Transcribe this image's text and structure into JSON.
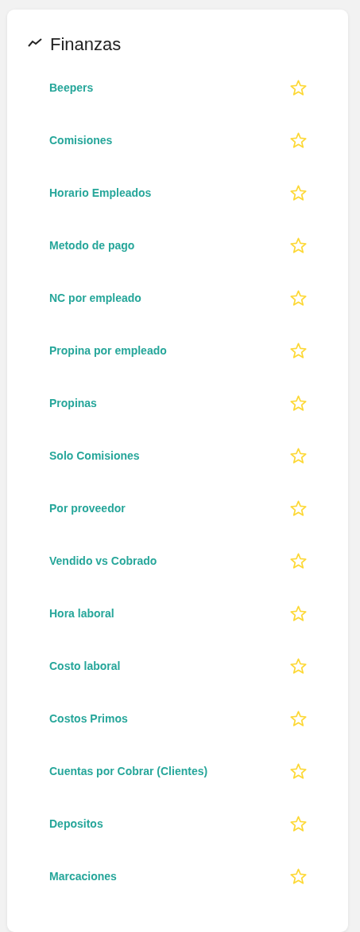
{
  "title": "Finanzas",
  "items": [
    {
      "label": "Beepers",
      "favorite": false
    },
    {
      "label": "Comisiones",
      "favorite": false
    },
    {
      "label": "Horario Empleados",
      "favorite": false
    },
    {
      "label": "Metodo de pago",
      "favorite": false
    },
    {
      "label": "NC por empleado",
      "favorite": false
    },
    {
      "label": "Propina por empleado",
      "favorite": false
    },
    {
      "label": "Propinas",
      "favorite": false
    },
    {
      "label": "Solo Comisiones",
      "favorite": false
    },
    {
      "label": "Por proveedor",
      "favorite": false
    },
    {
      "label": "Vendido vs Cobrado",
      "favorite": false
    },
    {
      "label": "Hora laboral",
      "favorite": false
    },
    {
      "label": "Costo laboral",
      "favorite": false
    },
    {
      "label": "Costos Primos",
      "favorite": false
    },
    {
      "label": "Cuentas por Cobrar (Clientes)",
      "favorite": false
    },
    {
      "label": "Depositos",
      "favorite": false
    },
    {
      "label": "Marcaciones",
      "favorite": false
    }
  ]
}
